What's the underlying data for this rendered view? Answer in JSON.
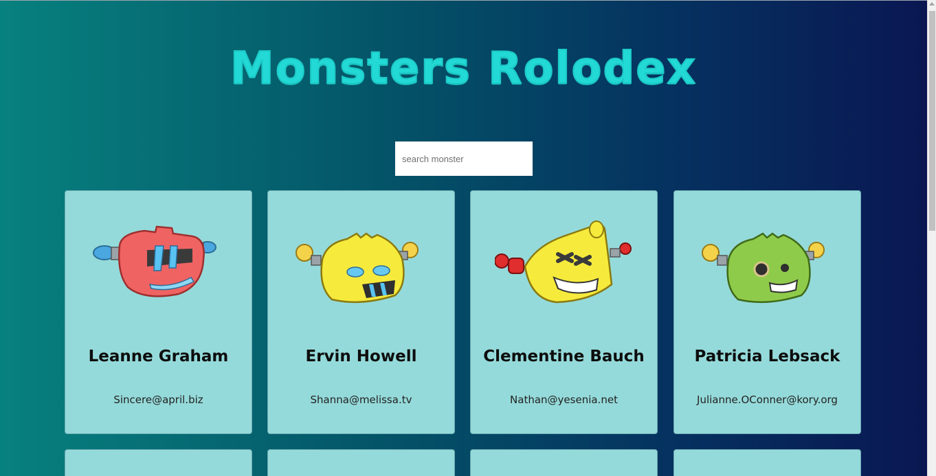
{
  "app": {
    "title": "Monsters Rolodex"
  },
  "search": {
    "placeholder": "search monster",
    "value": ""
  },
  "monsters": [
    {
      "name": "Leanne Graham",
      "email": "Sincere@april.biz",
      "color": "#f06363",
      "icon": "red-robot-icon"
    },
    {
      "name": "Ervin Howell",
      "email": "Shanna@melissa.tv",
      "color": "#f6ea3c",
      "icon": "yellow-robot-icon"
    },
    {
      "name": "Clementine Bauch",
      "email": "Nathan@yesenia.net",
      "color": "#f6ea3c",
      "icon": "yellow-robot-icon"
    },
    {
      "name": "Patricia Lebsack",
      "email": "Julianne.OConner@kory.org",
      "color": "#8fcb4a",
      "icon": "green-robot-icon"
    }
  ],
  "colors": {
    "accent": "#22d9d6",
    "card": "#95dada",
    "gradient_start": "#07817f",
    "gradient_end": "#0a1752"
  }
}
